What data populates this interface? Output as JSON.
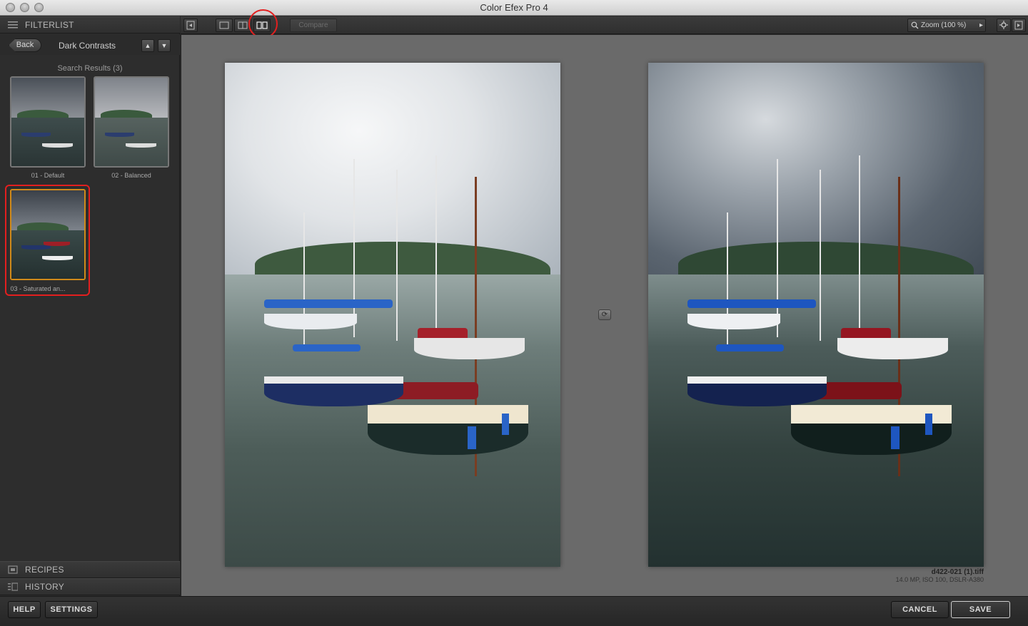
{
  "window": {
    "title": "Color Efex Pro 4"
  },
  "sidebar": {
    "filterlist_label": "FILTERLIST",
    "back_label": "Back",
    "nav_title": "Dark Contrasts",
    "up_arrow": "▲",
    "down_arrow": "▼",
    "results_title": "Search Results (3)",
    "thumbnails": [
      {
        "label": "01 - Default"
      },
      {
        "label": "02 - Balanced"
      },
      {
        "label": "03 - Saturated an..."
      }
    ],
    "recipes_label": "RECIPES",
    "history_label": "HISTORY"
  },
  "toolbar": {
    "compare_label": "Compare",
    "zoom_label": "Zoom (100 %)",
    "zoom_arrow": "▸"
  },
  "canvas": {
    "swap_icon": "⟳",
    "file_name": "d422-021 (1).tiff",
    "file_meta": "14.0 MP, ISO 100, DSLR-A380"
  },
  "bottom": {
    "help_label": "HELP",
    "settings_label": "SETTINGS",
    "cancel_label": "CANCEL",
    "save_label": "SAVE"
  },
  "colors": {
    "highlight": "#e31f1f",
    "selected_thumb_border": "#d08a1a"
  }
}
